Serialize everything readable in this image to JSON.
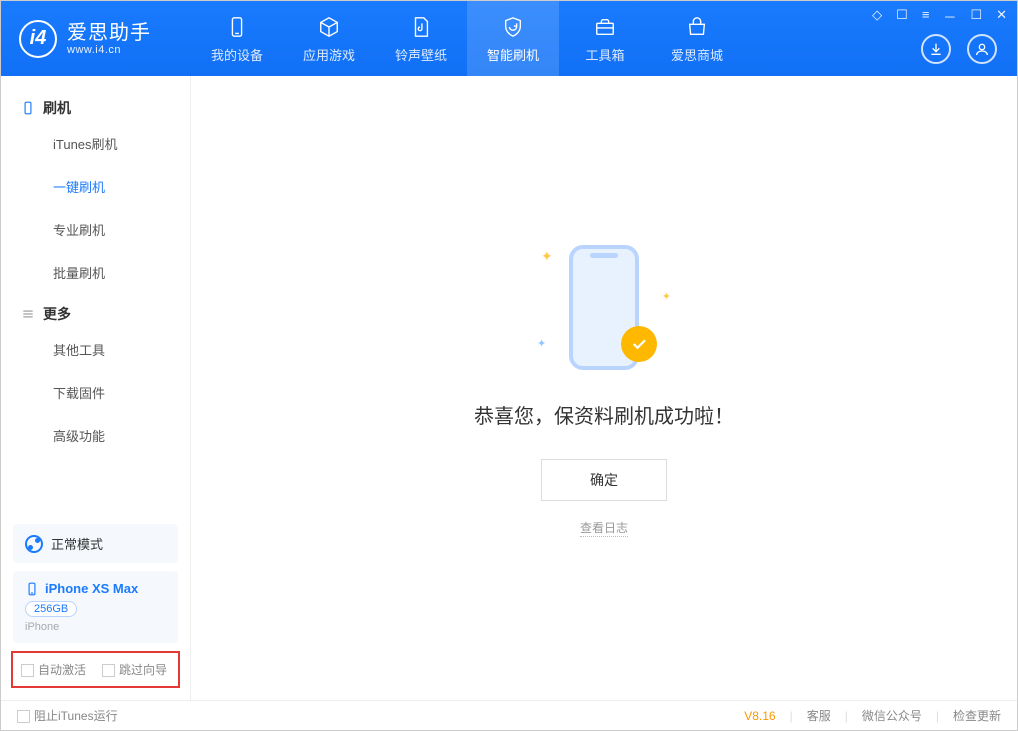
{
  "app": {
    "title": "爱思助手",
    "subtitle": "www.i4.cn"
  },
  "nav": [
    {
      "label": "我的设备",
      "icon": "device"
    },
    {
      "label": "应用游戏",
      "icon": "cube"
    },
    {
      "label": "铃声壁纸",
      "icon": "music"
    },
    {
      "label": "智能刷机",
      "icon": "refresh",
      "active": true
    },
    {
      "label": "工具箱",
      "icon": "toolbox"
    },
    {
      "label": "爱思商城",
      "icon": "shop"
    }
  ],
  "sidebar": {
    "group1": {
      "title": "刷机",
      "items": [
        "iTunes刷机",
        "一键刷机",
        "专业刷机",
        "批量刷机"
      ],
      "active_index": 1
    },
    "group2": {
      "title": "更多",
      "items": [
        "其他工具",
        "下载固件",
        "高级功能"
      ]
    }
  },
  "mode": {
    "label": "正常模式"
  },
  "device": {
    "name": "iPhone XS Max",
    "storage": "256GB",
    "type": "iPhone"
  },
  "checkboxes": {
    "auto_activate": "自动激活",
    "skip_guide": "跳过向导"
  },
  "main": {
    "success_message": "恭喜您，保资料刷机成功啦！",
    "ok_button": "确定",
    "view_log": "查看日志"
  },
  "footer": {
    "block_itunes": "阻止iTunes运行",
    "version": "V8.16",
    "links": [
      "客服",
      "微信公众号",
      "检查更新"
    ]
  }
}
